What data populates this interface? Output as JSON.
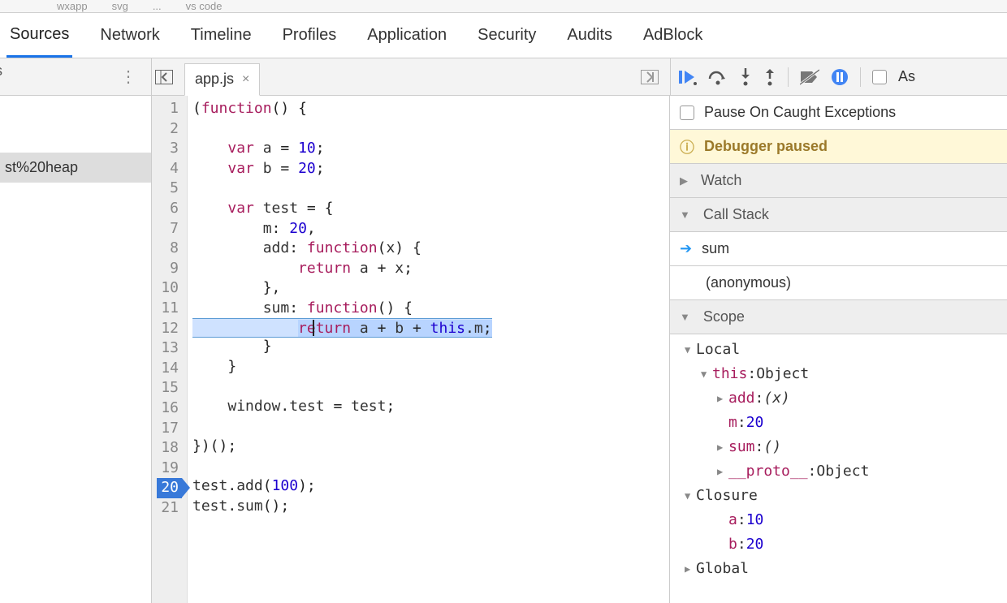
{
  "top_crumbs": [
    "wxapp",
    "svg",
    "...",
    "vs code"
  ],
  "main_tabs": [
    "Sources",
    "Network",
    "Timeline",
    "Profiles",
    "Application",
    "Security",
    "Audits",
    "AdBlock"
  ],
  "active_main_tab": 0,
  "sidebar": {
    "partial_top_label": "s",
    "items": [
      "st%20heap"
    ],
    "selected": 0
  },
  "filetab": {
    "name": "app.js",
    "close_glyph": "×"
  },
  "code": {
    "lines": [
      {
        "n": 1,
        "tokens": [
          [
            "delim",
            "("
          ],
          [
            "tok-fn",
            "function"
          ],
          [
            "delim",
            "()"
          ],
          [
            "delim",
            " {"
          ]
        ]
      },
      {
        "n": 2,
        "tokens": []
      },
      {
        "n": 3,
        "tokens": [
          [
            "space",
            "    "
          ],
          [
            "tok-kw",
            "var"
          ],
          [
            "space",
            " "
          ],
          [
            "tok-ident",
            "a"
          ],
          [
            "space",
            " "
          ],
          [
            "delim",
            "="
          ],
          [
            "space",
            " "
          ],
          [
            "tok-num",
            "10"
          ],
          [
            "delim",
            ";"
          ]
        ]
      },
      {
        "n": 4,
        "tokens": [
          [
            "space",
            "    "
          ],
          [
            "tok-kw",
            "var"
          ],
          [
            "space",
            " "
          ],
          [
            "tok-ident",
            "b"
          ],
          [
            "space",
            " "
          ],
          [
            "delim",
            "="
          ],
          [
            "space",
            " "
          ],
          [
            "tok-num",
            "20"
          ],
          [
            "delim",
            ";"
          ]
        ]
      },
      {
        "n": 5,
        "tokens": []
      },
      {
        "n": 6,
        "tokens": [
          [
            "space",
            "    "
          ],
          [
            "tok-kw",
            "var"
          ],
          [
            "space",
            " "
          ],
          [
            "tok-ident",
            "test"
          ],
          [
            "space",
            " "
          ],
          [
            "delim",
            "="
          ],
          [
            "space",
            " "
          ],
          [
            "delim",
            "{"
          ]
        ]
      },
      {
        "n": 7,
        "tokens": [
          [
            "space",
            "        "
          ],
          [
            "tok-ident",
            "m"
          ],
          [
            "delim",
            ":"
          ],
          [
            "space",
            " "
          ],
          [
            "tok-num",
            "20"
          ],
          [
            "delim",
            ","
          ]
        ]
      },
      {
        "n": 8,
        "tokens": [
          [
            "space",
            "        "
          ],
          [
            "tok-ident",
            "add"
          ],
          [
            "delim",
            ":"
          ],
          [
            "space",
            " "
          ],
          [
            "tok-fn",
            "function"
          ],
          [
            "delim",
            "("
          ],
          [
            "tok-ident",
            "x"
          ],
          [
            "delim",
            ")"
          ],
          [
            "space",
            " "
          ],
          [
            "delim",
            "{"
          ]
        ]
      },
      {
        "n": 9,
        "tokens": [
          [
            "space",
            "            "
          ],
          [
            "tok-kw",
            "return"
          ],
          [
            "space",
            " "
          ],
          [
            "tok-ident",
            "a"
          ],
          [
            "space",
            " "
          ],
          [
            "delim",
            "+"
          ],
          [
            "space",
            " "
          ],
          [
            "tok-ident",
            "x"
          ],
          [
            "delim",
            ";"
          ]
        ]
      },
      {
        "n": 10,
        "tokens": [
          [
            "space",
            "        "
          ],
          [
            "delim",
            "},"
          ]
        ]
      },
      {
        "n": 11,
        "tokens": [
          [
            "space",
            "        "
          ],
          [
            "tok-ident",
            "sum"
          ],
          [
            "delim",
            ":"
          ],
          [
            "space",
            " "
          ],
          [
            "tok-fn",
            "function"
          ],
          [
            "delim",
            "()"
          ],
          [
            "space",
            " "
          ],
          [
            "delim",
            "{"
          ]
        ]
      },
      {
        "n": 12,
        "hl": true,
        "tokens": [
          [
            "space",
            "            "
          ],
          [
            "hl-start",
            ""
          ],
          [
            "tok-kw",
            "return"
          ],
          [
            "space",
            " "
          ],
          [
            "tok-ident",
            "a"
          ],
          [
            "space",
            " "
          ],
          [
            "delim",
            "+"
          ],
          [
            "space",
            " "
          ],
          [
            "tok-ident",
            "b"
          ],
          [
            "space",
            " "
          ],
          [
            "delim",
            "+"
          ],
          [
            "space",
            " "
          ],
          [
            "tok-this",
            "this"
          ],
          [
            "delim",
            "."
          ],
          [
            "tok-ident",
            "m"
          ],
          [
            "delim",
            ";"
          ],
          [
            "hl-end",
            ""
          ]
        ]
      },
      {
        "n": 13,
        "tokens": [
          [
            "space",
            "        "
          ],
          [
            "delim",
            "}"
          ]
        ]
      },
      {
        "n": 14,
        "tokens": [
          [
            "space",
            "    "
          ],
          [
            "delim",
            "}"
          ]
        ]
      },
      {
        "n": 15,
        "tokens": []
      },
      {
        "n": 16,
        "tokens": [
          [
            "space",
            "    "
          ],
          [
            "tok-ident",
            "window"
          ],
          [
            "delim",
            "."
          ],
          [
            "tok-ident",
            "test"
          ],
          [
            "space",
            " "
          ],
          [
            "delim",
            "="
          ],
          [
            "space",
            " "
          ],
          [
            "tok-ident",
            "test"
          ],
          [
            "delim",
            ";"
          ]
        ]
      },
      {
        "n": 17,
        "tokens": []
      },
      {
        "n": 18,
        "tokens": [
          [
            "delim",
            "})();"
          ]
        ]
      },
      {
        "n": 19,
        "tokens": []
      },
      {
        "n": 20,
        "bp": true,
        "tokens": [
          [
            "tok-ident",
            "test"
          ],
          [
            "delim",
            "."
          ],
          [
            "tok-ident",
            "add"
          ],
          [
            "delim",
            "("
          ],
          [
            "tok-num",
            "100"
          ],
          [
            "delim",
            ");"
          ]
        ]
      },
      {
        "n": 21,
        "tokens": [
          [
            "tok-ident",
            "test"
          ],
          [
            "delim",
            "."
          ],
          [
            "tok-ident",
            "sum"
          ],
          [
            "delim",
            "();"
          ]
        ]
      }
    ]
  },
  "debug": {
    "pause_caught_label": "Pause On Caught Exceptions",
    "banner": "Debugger paused",
    "watch_label": "Watch",
    "callstack_label": "Call Stack",
    "callstack": [
      {
        "name": "sum",
        "current": true
      },
      {
        "name": "(anonymous)",
        "current": false
      }
    ],
    "scope_label": "Scope",
    "scope": {
      "Local": {
        "expanded": true,
        "this_label": "this",
        "this_type": "Object",
        "this_props": [
          {
            "name": "add",
            "display": "(x)",
            "kind": "func",
            "expandable": true
          },
          {
            "name": "m",
            "display": "20",
            "kind": "num",
            "expandable": false
          },
          {
            "name": "sum",
            "display": "()",
            "kind": "func",
            "expandable": true
          },
          {
            "name": "__proto__",
            "display": "Object",
            "kind": "obj",
            "expandable": true
          }
        ]
      },
      "Closure": {
        "expanded": true,
        "vars": [
          {
            "name": "a",
            "display": "10",
            "kind": "num"
          },
          {
            "name": "b",
            "display": "20",
            "kind": "num"
          }
        ]
      },
      "Global": {
        "expanded": false
      }
    },
    "truncated_right": "As"
  }
}
